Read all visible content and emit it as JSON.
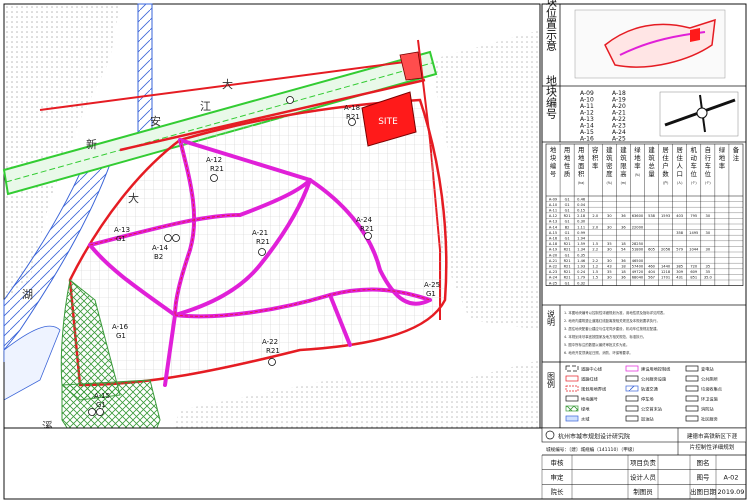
{
  "colors": {
    "road_outline": "#e51c23",
    "main_road": "#e020d8",
    "expressway_green": "#33cc33",
    "railway_blue": "#3a64d8",
    "site_red": "#ff1a1a",
    "hatch_green": "#3a9a3a",
    "block_line": "#b5b5b5",
    "coast_dots": "#b8b8b8"
  },
  "map": {
    "site_label": "SITE",
    "place_chars": [
      "大",
      "江",
      "新",
      "安",
      "大",
      "湖",
      "溪"
    ],
    "parcels": [
      {
        "id": "A-12",
        "code": "R21"
      },
      {
        "id": "A-14",
        "code": "B2"
      },
      {
        "id": "A-16",
        "code": "G1"
      },
      {
        "id": "A-15",
        "code": "G1"
      },
      {
        "id": "A-21",
        "code": "R21"
      },
      {
        "id": "A-22",
        "code": "R21"
      },
      {
        "id": "A-24",
        "code": "R21"
      },
      {
        "id": "A-13",
        "code": "G1"
      },
      {
        "id": "A-25",
        "code": "G1"
      },
      {
        "id": "A-18",
        "code": "R21"
      }
    ]
  },
  "panel": {
    "location_title": "地块位置示意",
    "number_title": "地块编号",
    "block_ids_col1": [
      "A-09",
      "A-10",
      "A-11",
      "A-12",
      "A-13",
      "A-14",
      "A-15",
      "A-16"
    ],
    "block_ids_col2": [
      "A-18",
      "A-19",
      "A-20",
      "A-21",
      "A-22",
      "A-23",
      "A-24",
      "A-25"
    ],
    "table_headers": [
      "地块编号",
      "用地性质",
      "用地面积(ha)",
      "容积率",
      "建筑密度(%)",
      "建筑限高(m)",
      "绿地率(%)",
      "建筑总量",
      "居住户数(户)",
      "居住人口(人)",
      "机动车位(个)",
      "自行车位(个)",
      "绿地率",
      "备注"
    ],
    "table_rows": [
      [
        "A-09",
        "G1",
        "0.46"
      ],
      [
        "A-10",
        "G1",
        "0.04"
      ],
      [
        "A-11",
        "G1",
        "0.15"
      ],
      [
        "A-12",
        "R21",
        "2.18",
        "2.0",
        "30",
        "36",
        "63600",
        "538",
        "1593",
        "403",
        "795",
        "30"
      ],
      [
        "A-13",
        "G1",
        "0.30"
      ],
      [
        "A-14",
        "B2",
        "1.11",
        "2.0",
        "30",
        "36",
        "22000"
      ],
      [
        "A-15",
        "G1",
        "0.99",
        "",
        "",
        "",
        "",
        "",
        "",
        "358",
        "1495",
        "30"
      ],
      [
        "A-16",
        "G1",
        "1.94"
      ],
      [
        "A-18",
        "R21",
        "1.59",
        "1.5",
        "35",
        "18",
        "28250"
      ],
      [
        "A-19",
        "R21",
        "1.34",
        "2.2",
        "30",
        "54",
        "51800",
        "605",
        "2056",
        "579",
        "1044",
        "30"
      ],
      [
        "A-20",
        "G1",
        "0.35"
      ],
      [
        "A-21",
        "R21",
        "1.46",
        "2.2",
        "30",
        "36",
        "46500"
      ],
      [
        "A-22",
        "R21",
        "1.93",
        "1.2",
        "43",
        "18",
        "57400",
        "460",
        "1440",
        "385",
        "720",
        "35"
      ],
      [
        "A-23",
        "R21",
        "0.24",
        "1.5",
        "35",
        "18",
        "49720",
        "404",
        "1218",
        "309",
        "609",
        "35"
      ],
      [
        "A-24",
        "R21",
        "1.79",
        "1.5",
        "30",
        "36",
        "68040",
        "567",
        "1701",
        "431",
        "851",
        "35.0"
      ],
      [
        "A-25",
        "G1",
        "0.32"
      ]
    ],
    "notes_label": "说明",
    "notes_lines": [
      "1. 本图地块编号以控制性详细规划为准，用地性质及指标详见附表。",
      "2. 地块内建筑退让道路红线距离按相关规范及本规划要求执行。",
      "3. 居住地块配套公建应与住宅同步建设，机动车位按规定配建。",
      "4. 本规划未尽事宜按国家及地方相关规范、标准执行。",
      "5. 图中所标注的数据以最终审批文件为准。",
      "6. 地块开发须满足日照、消防、环保等要求。"
    ],
    "legend_label": "图例",
    "legend_items": [
      "道路中心线",
      "道路红线",
      "规划用地界线",
      "地块编号",
      "绿地",
      "水域",
      "建设用地控制线",
      "公共服务设施",
      "轨道交通",
      "停车场",
      "公交首末站",
      "加油站",
      "变电站",
      "公共厕所",
      "垃圾收集点",
      "环卫设施",
      "消防站",
      "社区服务"
    ],
    "institute": "杭州市城市规划设计研究院",
    "cert": "城规编号：〔建〕城规编（141110）（甲级）",
    "project_title": "建德市高铁新区下涯片控制性详细规划",
    "sign_rows": [
      [
        "审核",
        "项目负责",
        "图名",
        ""
      ],
      [
        "审定",
        "设计人员",
        "图号",
        "A-02"
      ],
      [
        "院长",
        "制图员",
        "出图日期",
        "2019.09"
      ]
    ]
  }
}
